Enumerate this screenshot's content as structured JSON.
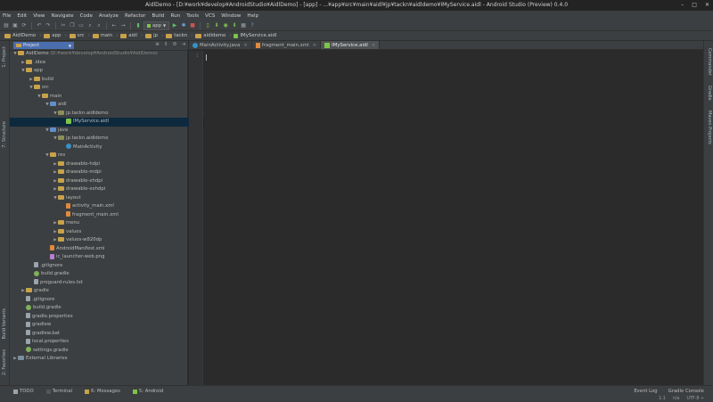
{
  "window": {
    "title": "AidlDemo - [D:¥work¥develop¥AndroidStudio¥AidlDemo] - [app] - ...¥app¥src¥main¥aidl¥jp¥tackn¥aidldemo¥IMyService.aidl - Android Studio (Preview) 0.4.0",
    "controls": [
      "–",
      "□",
      "✕"
    ]
  },
  "menu": [
    "File",
    "Edit",
    "View",
    "Navigate",
    "Code",
    "Analyze",
    "Refactor",
    "Build",
    "Run",
    "Tools",
    "VCS",
    "Window",
    "Help"
  ],
  "toolbar": {
    "run_config": "app",
    "icons": [
      "open-icon",
      "save-icon",
      "sync-icon",
      "undo-icon",
      "redo-icon",
      "cut-icon",
      "copy-icon",
      "paste-icon",
      "find-icon",
      "replace-icon",
      "back-icon",
      "forward-icon",
      "make-icon",
      "run-config-dropdown",
      "run-icon",
      "debug-icon",
      "stop-icon",
      "avd-manager-icon",
      "sdk-manager-icon",
      "monitor-icon",
      "gradle-sync-icon",
      "project-structure-icon",
      "help-icon"
    ]
  },
  "breadcrumb": [
    "AidlDemo",
    "app",
    "src",
    "main",
    "aidl",
    "jp",
    "tackn",
    "aidldemo",
    "IMyService.aidl"
  ],
  "left_tools": [
    "1: Project",
    "7: Structure",
    "Build Variants",
    "2: Favorites"
  ],
  "right_tools": [
    "Commander",
    "Gradle",
    "Maven Projects"
  ],
  "project_panel": {
    "view_label": "Project",
    "tree": [
      {
        "d": 0,
        "arrow": "down",
        "icon": "folder",
        "label": "AidlDemo",
        "path": " (D:¥work¥develop¥AndroidStudio¥AidlDemo)"
      },
      {
        "d": 1,
        "arrow": "right",
        "icon": "folder",
        "label": ".idea"
      },
      {
        "d": 1,
        "arrow": "down",
        "icon": "folder",
        "label": "app"
      },
      {
        "d": 2,
        "arrow": "right",
        "icon": "folder",
        "label": "build"
      },
      {
        "d": 2,
        "arrow": "down",
        "icon": "folder",
        "label": "src"
      },
      {
        "d": 3,
        "arrow": "down",
        "icon": "folder",
        "label": "main"
      },
      {
        "d": 4,
        "arrow": "down",
        "icon": "srcfolder",
        "label": "aidl"
      },
      {
        "d": 5,
        "arrow": "down",
        "icon": "pkg",
        "label": "jp.tackn.aidldemo"
      },
      {
        "d": 6,
        "arrow": "",
        "icon": "aidl",
        "label": "IMyService.aidl",
        "selected": true
      },
      {
        "d": 4,
        "arrow": "down",
        "icon": "srcfolder",
        "label": "java"
      },
      {
        "d": 5,
        "arrow": "down",
        "icon": "pkg",
        "label": "jp.tackn.aidldemo"
      },
      {
        "d": 6,
        "arrow": "",
        "icon": "cls",
        "label": "MainActivity"
      },
      {
        "d": 4,
        "arrow": "down",
        "icon": "folder",
        "label": "res"
      },
      {
        "d": 5,
        "arrow": "right",
        "icon": "folder",
        "label": "drawable-hdpi"
      },
      {
        "d": 5,
        "arrow": "right",
        "icon": "folder",
        "label": "drawable-mdpi"
      },
      {
        "d": 5,
        "arrow": "right",
        "icon": "folder",
        "label": "drawable-xhdpi"
      },
      {
        "d": 5,
        "arrow": "right",
        "icon": "folder",
        "label": "drawable-xxhdpi"
      },
      {
        "d": 5,
        "arrow": "down",
        "icon": "folder",
        "label": "layout"
      },
      {
        "d": 6,
        "arrow": "",
        "icon": "xml",
        "label": "activity_main.xml"
      },
      {
        "d": 6,
        "arrow": "",
        "icon": "xml",
        "label": "fragment_main.xml"
      },
      {
        "d": 5,
        "arrow": "right",
        "icon": "folder",
        "label": "menu"
      },
      {
        "d": 5,
        "arrow": "right",
        "icon": "folder",
        "label": "values"
      },
      {
        "d": 5,
        "arrow": "right",
        "icon": "folder",
        "label": "values-w820dp"
      },
      {
        "d": 4,
        "arrow": "",
        "icon": "xml",
        "label": "AndroidManifest.xml"
      },
      {
        "d": 4,
        "arrow": "",
        "icon": "png",
        "label": "ic_launcher-web.png"
      },
      {
        "d": 2,
        "arrow": "",
        "icon": "file",
        "label": ".gitignore"
      },
      {
        "d": 2,
        "arrow": "",
        "icon": "gradle",
        "label": "build.gradle"
      },
      {
        "d": 2,
        "arrow": "",
        "icon": "file",
        "label": "proguard-rules.txt"
      },
      {
        "d": 1,
        "arrow": "right",
        "icon": "folder",
        "label": "gradle"
      },
      {
        "d": 1,
        "arrow": "",
        "icon": "file",
        "label": ".gitignore"
      },
      {
        "d": 1,
        "arrow": "",
        "icon": "gradle",
        "label": "build.gradle"
      },
      {
        "d": 1,
        "arrow": "",
        "icon": "file",
        "label": "gradle.properties"
      },
      {
        "d": 1,
        "arrow": "",
        "icon": "file",
        "label": "gradlew"
      },
      {
        "d": 1,
        "arrow": "",
        "icon": "file",
        "label": "gradlew.bat"
      },
      {
        "d": 1,
        "arrow": "",
        "icon": "file",
        "label": "local.properties"
      },
      {
        "d": 1,
        "arrow": "",
        "icon": "gradle",
        "label": "settings.gradle"
      },
      {
        "d": 0,
        "arrow": "right",
        "icon": "lib",
        "label": "External Libraries"
      }
    ]
  },
  "editor": {
    "tabs": [
      {
        "label": "MainActivity.java",
        "icon": "cls",
        "active": false
      },
      {
        "label": "fragment_main.xml",
        "icon": "xml",
        "active": false
      },
      {
        "label": "IMyService.aidl",
        "icon": "aidl",
        "active": true
      }
    ],
    "line_number": "1"
  },
  "status": {
    "tools": [
      "TODO",
      "Terminal",
      "6: Messages",
      "5: Android"
    ],
    "right_tools": [
      "Event Log",
      "Gradle Console"
    ],
    "info": [
      "1:1",
      "n/a",
      "UTF-8 ÷"
    ]
  }
}
